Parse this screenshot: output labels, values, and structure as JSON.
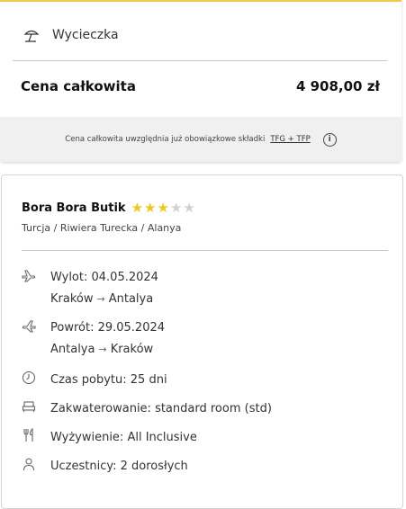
{
  "summary": {
    "trip_label": "Wycieczka",
    "total_label": "Cena całkowita",
    "total_value": "4 908,00 zł",
    "note_text": "Cena całkowita uwzględnia już obowiązkowe składki",
    "note_link": "TFG + TFP",
    "info_icon_char": "i"
  },
  "hotel": {
    "name": "Bora Bora Butik",
    "stars_filled": 3,
    "stars_total": 5,
    "star_char": "★",
    "location": "Turcja / Riwiera Turecka / Alanya"
  },
  "details": {
    "departure": {
      "date": "Wylot: 04.05.2024",
      "from": "Kraków",
      "to": "Antalya"
    },
    "return": {
      "date": "Powrót: 29.05.2024",
      "from": "Antalya",
      "to": "Kraków"
    },
    "arrow": "→",
    "stay": "Czas pobytu:  25 dni",
    "accommodation": "Zakwaterowanie:  standard room (std)",
    "board": "Wyżywienie:  All Inclusive",
    "participants": "Uczestnicy:  2 dorosłych"
  },
  "colors": {
    "accent": "#f2c94c",
    "star_on": "#f5c518",
    "star_off": "#d0d0d0"
  }
}
